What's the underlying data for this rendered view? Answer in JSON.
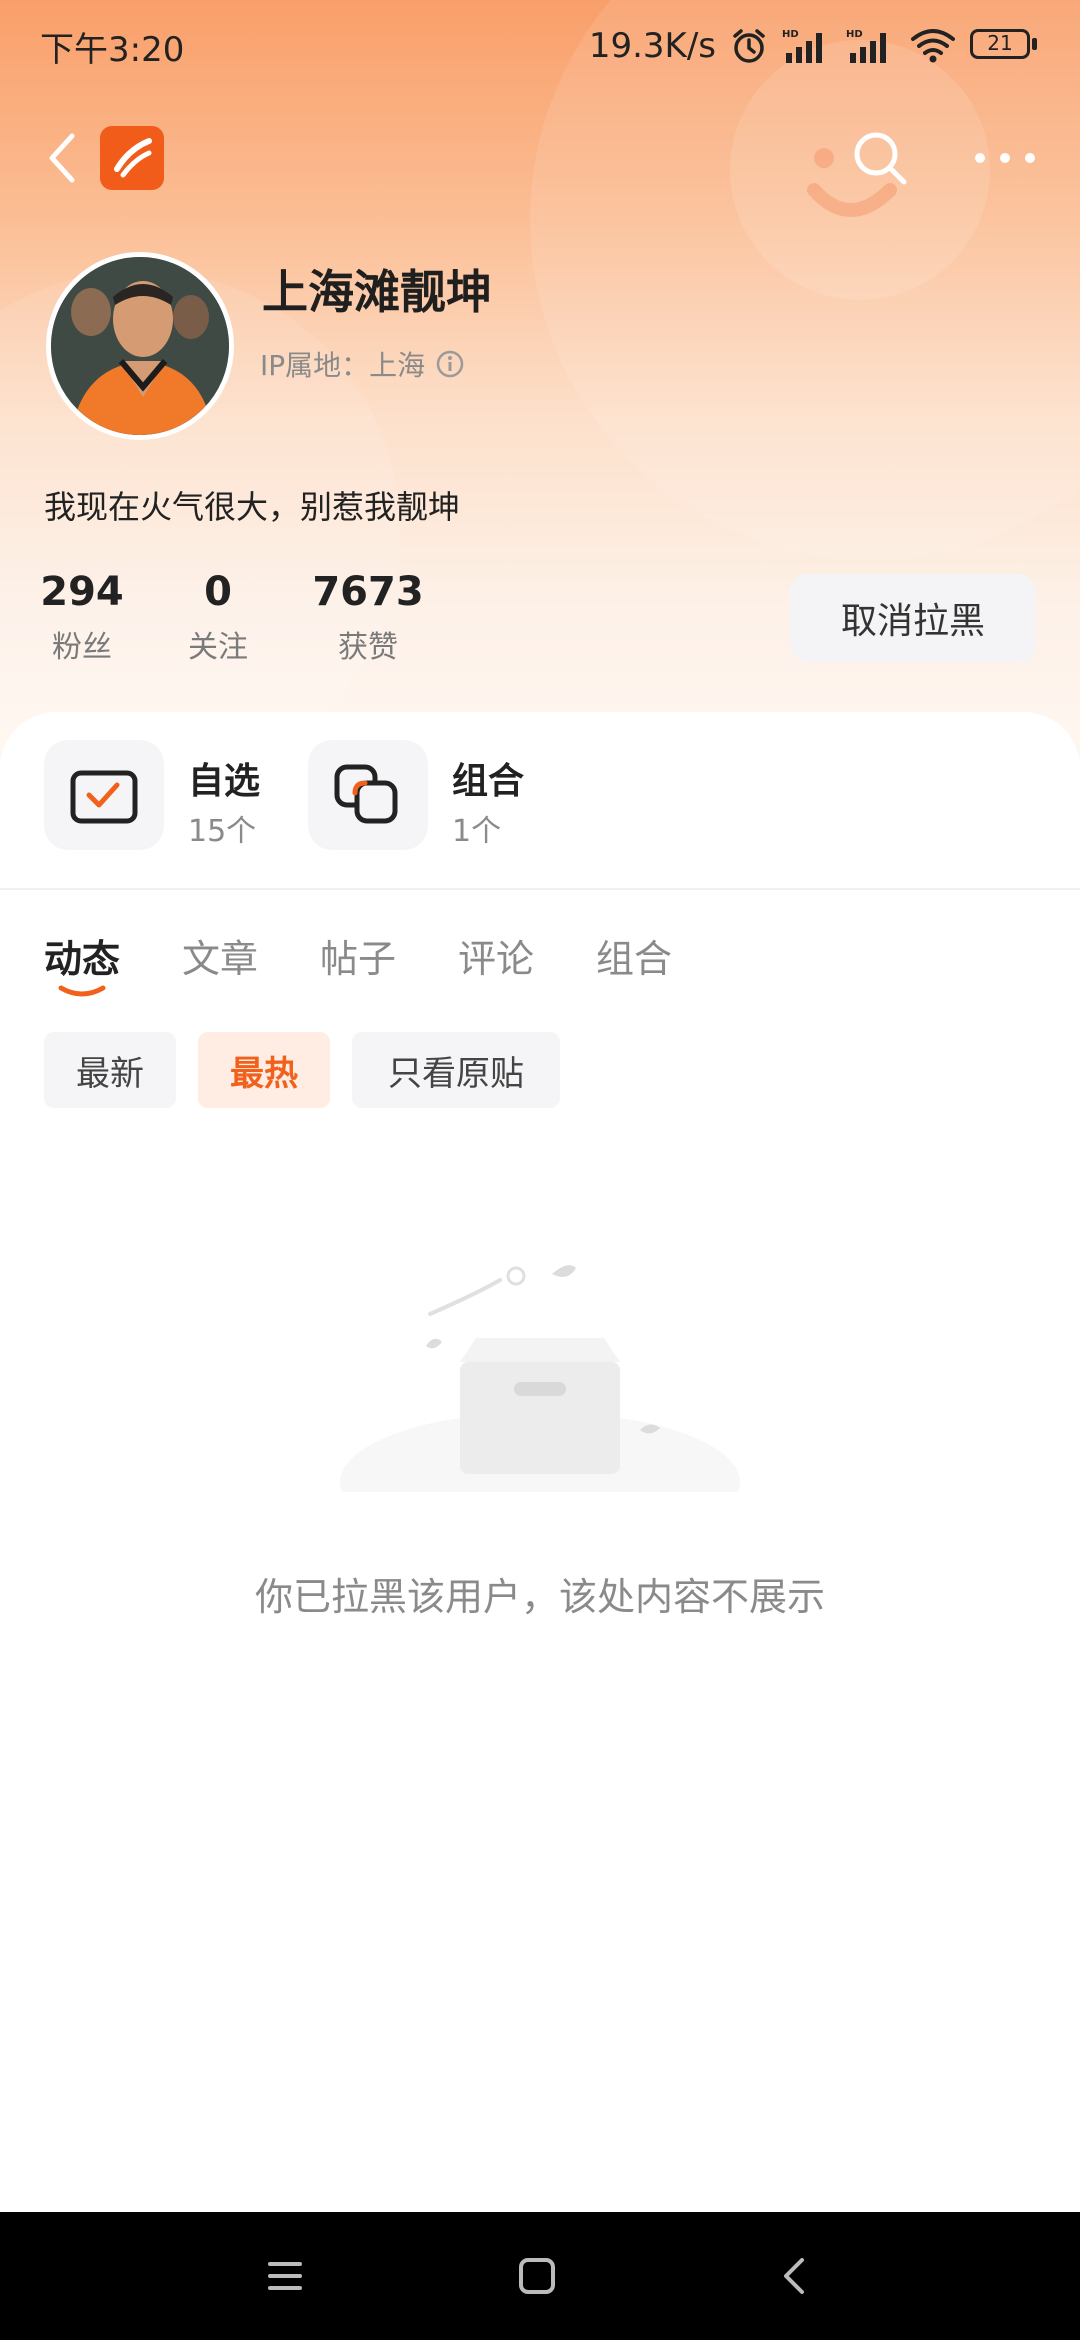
{
  "status_bar": {
    "time": "下午3:20",
    "network_speed": "19.3K/s",
    "battery": "21",
    "icons": [
      "alarm-icon",
      "signal-hd-icon",
      "signal-hd-icon",
      "wifi-icon",
      "battery-icon"
    ]
  },
  "colors": {
    "accent": "#f2611c",
    "header_gradient_top": "#f99f6a",
    "chip_active_bg": "#ffece3"
  },
  "profile": {
    "username": "上海滩靓坤",
    "ip_location": "IP属地：上海",
    "bio": "我现在火气很大，别惹我靓坤",
    "stats": [
      {
        "value": "294",
        "label": "粉丝"
      },
      {
        "value": "0",
        "label": "关注"
      },
      {
        "value": "7673",
        "label": "获赞"
      }
    ],
    "unblock_label": "取消拉黑"
  },
  "features": [
    {
      "title": "自选",
      "count": "15个",
      "icon": "watchlist-check-icon"
    },
    {
      "title": "组合",
      "count": "1个",
      "icon": "portfolio-squares-icon"
    }
  ],
  "tabs": [
    "动态",
    "文章",
    "帖子",
    "评论",
    "组合"
  ],
  "active_tab": "动态",
  "filters": [
    "最新",
    "最热",
    "只看原贴"
  ],
  "active_filter": "最热",
  "empty_state": {
    "message": "你已拉黑该用户，该处内容不展示",
    "icon": "empty-box-icon"
  },
  "navbar": {
    "icons": [
      "menu-icon",
      "home-square-icon",
      "back-arrow-icon"
    ]
  }
}
